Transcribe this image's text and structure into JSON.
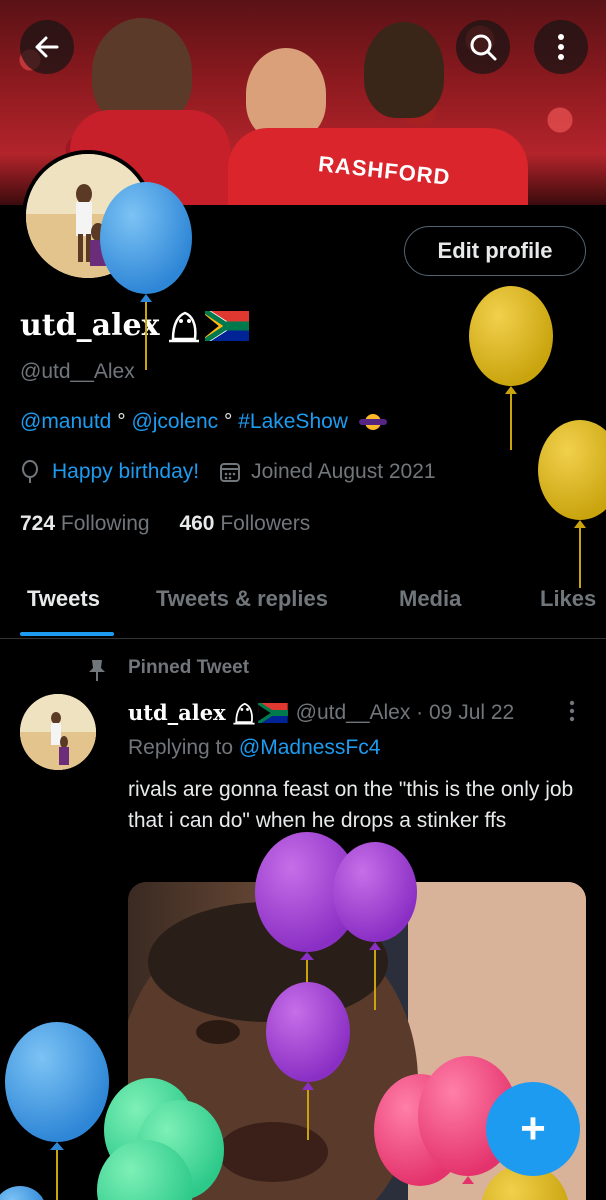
{
  "profile": {
    "name": "utd_alex",
    "handle": "@utd__Alex",
    "edit_label": "Edit profile",
    "bio": {
      "mention1": "@manutd",
      "sep": " ° ",
      "mention2": "@jcolenc",
      "sep2": " ° ",
      "hashtag": "#LakeShow"
    },
    "birthday": "Happy birthday!",
    "joined": "Joined August 2021",
    "following_count": "724",
    "following_label": "Following",
    "followers_count": "460",
    "followers_label": "Followers"
  },
  "banner": {
    "jersey_text": "RASHFORD"
  },
  "tabs": [
    "Tweets",
    "Tweets & replies",
    "Media",
    "Likes"
  ],
  "pinned_tweet": {
    "label": "Pinned Tweet",
    "name": "utd_alex",
    "handle_date": "@utd__Alex · 09 Jul 22",
    "replying_prefix": "Replying to ",
    "replying_to": "@MadnessFc4",
    "text": "rivals are gonna feast on the \"this is the only job that i can do\" when he drops a stinker ffs"
  },
  "fab_label": "+",
  "icons": {
    "back": "arrow-left-icon",
    "search": "search-icon",
    "more": "more-vertical-icon",
    "birthday": "balloon-icon",
    "calendar": "calendar-icon",
    "pin": "pin-icon"
  },
  "colors": {
    "accent": "#1d9bf0",
    "background": "#000000",
    "muted": "#71767b"
  }
}
